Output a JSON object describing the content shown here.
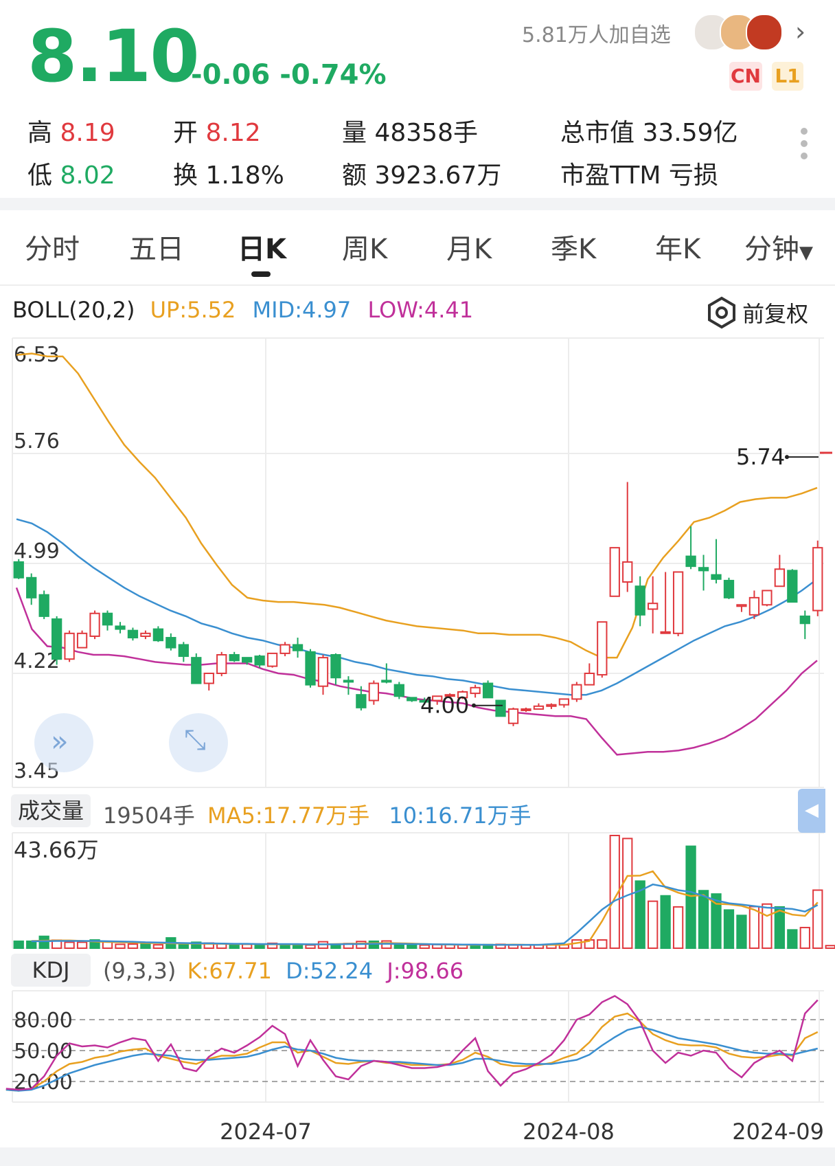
{
  "header": {
    "price": "8.10",
    "change": "-0.06 -0.74%",
    "followers": "5.81万人加自选",
    "badges": [
      "CN",
      "L1"
    ]
  },
  "stats": {
    "high_label": "高",
    "high": "8.19",
    "open_label": "开",
    "open": "8.12",
    "volume_label": "量",
    "volume": "48358手",
    "mktcap_label": "总市值",
    "mktcap": "33.59亿",
    "low_label": "低",
    "low": "8.02",
    "turnover_label": "换",
    "turnover": "1.18%",
    "amount_label": "额",
    "amount": "3923.67万",
    "pe_label": "市盈TTM",
    "pe": "亏损"
  },
  "tabs": [
    "分时",
    "五日",
    "日K",
    "周K",
    "月K",
    "季K",
    "年K",
    "分钟"
  ],
  "active_tab": "日K",
  "boll": {
    "name": "BOLL(20,2)",
    "up": "UP:5.52",
    "mid": "MID:4.97",
    "low": "LOW:4.41",
    "adjust": "前复权"
  },
  "colors": {
    "up": "#e0393e",
    "down": "#1faa62",
    "upper": "#e8a020",
    "mid": "#3a8fd0",
    "lower": "#c0309a"
  },
  "volume_legend": {
    "label": "成交量",
    "value": "19504手",
    "ma5": "MA5:17.77万手",
    "ma10": "10:16.71万手"
  },
  "kdj_legend": {
    "label": "KDJ",
    "params": "(9,3,3)",
    "k": "K:67.71",
    "d": "D:52.24",
    "j": "J:98.66"
  },
  "chart_data": [
    {
      "type": "candlestick",
      "title": "",
      "y_ticks": [
        "6.53",
        "5.76",
        "4.99",
        "4.22",
        "3.45"
      ],
      "ylim": [
        3.45,
        6.53
      ],
      "x_ticks": [
        "2024-07",
        "2024-08",
        "2024-09"
      ],
      "annotations": {
        "max": "5.74",
        "min": "4.00"
      },
      "candles": [
        [
          5.0,
          4.89,
          5.02,
          4.88
        ],
        [
          4.89,
          4.75,
          4.92,
          4.7
        ],
        [
          4.77,
          4.62,
          4.8,
          4.6
        ],
        [
          4.6,
          4.32,
          4.62,
          4.28
        ],
        [
          4.32,
          4.5,
          4.52,
          4.3
        ],
        [
          4.4,
          4.5,
          4.52,
          4.4
        ],
        [
          4.48,
          4.64,
          4.66,
          4.46
        ],
        [
          4.64,
          4.56,
          4.66,
          4.52
        ],
        [
          4.55,
          4.53,
          4.58,
          4.5
        ],
        [
          4.52,
          4.47,
          4.54,
          4.45
        ],
        [
          4.48,
          4.5,
          4.52,
          4.46
        ],
        [
          4.53,
          4.45,
          4.55,
          4.44
        ],
        [
          4.47,
          4.4,
          4.5,
          4.38
        ],
        [
          4.42,
          4.34,
          4.44,
          4.3
        ],
        [
          4.33,
          4.15,
          4.36,
          4.15
        ],
        [
          4.15,
          4.22,
          4.22,
          4.1
        ],
        [
          4.22,
          4.35,
          4.37,
          4.2
        ],
        [
          4.35,
          4.31,
          4.37,
          4.3
        ],
        [
          4.33,
          4.3,
          4.33,
          4.28
        ],
        [
          4.34,
          4.28,
          4.35,
          4.26
        ],
        [
          4.27,
          4.36,
          4.36,
          4.26
        ],
        [
          4.36,
          4.42,
          4.44,
          4.34
        ],
        [
          4.42,
          4.38,
          4.47,
          4.33
        ],
        [
          4.37,
          4.14,
          4.39,
          4.12
        ],
        [
          4.13,
          4.33,
          4.35,
          4.07
        ],
        [
          4.35,
          4.19,
          4.36,
          4.14
        ],
        [
          4.17,
          4.16,
          4.2,
          4.07
        ],
        [
          4.07,
          3.98,
          4.13,
          3.96
        ],
        [
          4.03,
          4.15,
          4.17,
          4.0
        ],
        [
          4.17,
          4.16,
          4.29,
          4.15
        ],
        [
          4.14,
          4.06,
          4.16,
          4.04
        ],
        [
          4.05,
          4.03,
          4.05,
          4.02
        ],
        [
          4.03,
          4.02,
          4.05,
          4.0
        ],
        [
          4.03,
          4.06,
          4.06,
          4.0
        ],
        [
          4.07,
          4.07,
          4.08,
          4.05
        ],
        [
          4.05,
          4.09,
          4.1,
          4.04
        ],
        [
          4.08,
          4.12,
          4.14,
          4.05
        ],
        [
          4.15,
          4.05,
          4.17,
          4.05
        ],
        [
          4.03,
          3.92,
          4.03,
          3.92
        ],
        [
          3.87,
          3.97,
          3.98,
          3.85
        ],
        [
          3.97,
          3.97,
          3.98,
          3.95
        ],
        [
          3.97,
          3.99,
          4.01,
          3.97
        ],
        [
          3.99,
          4.0,
          4.01,
          3.97
        ],
        [
          4.0,
          4.04,
          4.04,
          3.98
        ],
        [
          4.04,
          4.14,
          4.16,
          4.02
        ],
        [
          4.14,
          4.22,
          4.29,
          4.2
        ],
        [
          4.21,
          4.58,
          4.58,
          4.19
        ],
        [
          4.76,
          5.1,
          5.1,
          4.76
        ],
        [
          4.86,
          5.0,
          5.56,
          4.79
        ],
        [
          4.83,
          4.63,
          4.9,
          4.55
        ],
        [
          4.67,
          4.71,
          4.9,
          4.5
        ],
        [
          4.51,
          4.51,
          4.93,
          4.5
        ],
        [
          4.5,
          4.93,
          4.93,
          4.48
        ],
        [
          5.04,
          4.97,
          5.25,
          4.95
        ],
        [
          4.96,
          4.94,
          5.05,
          4.8
        ],
        [
          4.91,
          4.88,
          5.16,
          4.85
        ],
        [
          4.87,
          4.75,
          4.89,
          4.74
        ],
        [
          4.69,
          4.7,
          4.7,
          4.65
        ],
        [
          4.63,
          4.75,
          4.8,
          4.6
        ],
        [
          4.7,
          4.8,
          4.8,
          4.69
        ],
        [
          4.83,
          4.95,
          5.05,
          4.83
        ],
        [
          4.94,
          4.72,
          4.95,
          4.72
        ],
        [
          4.62,
          4.57,
          4.66,
          4.46
        ],
        [
          4.66,
          5.1,
          5.15,
          4.62
        ]
      ],
      "series": [
        {
          "name": "UP",
          "values": [
            6.45,
            6.46,
            6.44,
            6.44,
            6.32,
            6.15,
            5.98,
            5.82,
            5.7,
            5.59,
            5.45,
            5.31,
            5.13,
            4.98,
            4.84,
            4.75,
            4.73,
            4.72,
            4.72,
            4.71,
            4.7,
            4.68,
            4.65,
            4.62,
            4.59,
            4.57,
            4.55,
            4.54,
            4.53,
            4.52,
            4.5,
            4.5,
            4.49,
            4.49,
            4.49,
            4.47,
            4.44,
            4.38,
            4.33,
            4.33,
            4.54,
            4.88,
            5.03,
            5.15,
            5.28,
            5.31,
            5.36,
            5.42,
            5.44,
            5.45,
            5.45,
            5.48,
            5.52
          ]
        },
        {
          "name": "MID",
          "values": [
            5.3,
            5.27,
            5.21,
            5.13,
            5.04,
            4.96,
            4.89,
            4.82,
            4.76,
            4.71,
            4.66,
            4.62,
            4.57,
            4.54,
            4.5,
            4.47,
            4.45,
            4.42,
            4.4,
            4.37,
            4.35,
            4.33,
            4.3,
            4.28,
            4.25,
            4.23,
            4.21,
            4.2,
            4.18,
            4.17,
            4.15,
            4.13,
            4.11,
            4.1,
            4.09,
            4.08,
            4.07,
            4.07,
            4.1,
            4.15,
            4.21,
            4.27,
            4.33,
            4.39,
            4.45,
            4.5,
            4.55,
            4.58,
            4.62,
            4.67,
            4.73,
            4.8,
            4.88
          ]
        },
        {
          "name": "LOW",
          "values": [
            4.82,
            4.53,
            4.41,
            4.4,
            4.37,
            4.35,
            4.35,
            4.34,
            4.32,
            4.3,
            4.29,
            4.28,
            4.28,
            4.29,
            4.29,
            4.29,
            4.25,
            4.22,
            4.21,
            4.18,
            4.16,
            4.13,
            4.11,
            4.09,
            4.08,
            4.06,
            4.04,
            4.03,
            4.02,
            4.01,
            3.98,
            3.96,
            3.95,
            3.94,
            3.93,
            3.92,
            3.92,
            3.9,
            3.77,
            3.65,
            3.66,
            3.67,
            3.67,
            3.68,
            3.7,
            3.73,
            3.77,
            3.83,
            3.9,
            4.0,
            4.1,
            4.22,
            4.31
          ]
        }
      ]
    },
    {
      "type": "bar",
      "title": "",
      "y_ticks": [
        "43.66万"
      ],
      "values_wan": [
        2.7,
        2.7,
        4.6,
        3.1,
        2.3,
        2.3,
        3.2,
        2.6,
        1.5,
        1.6,
        1.6,
        1.3,
        4.0,
        1.3,
        2.3,
        2.0,
        1.8,
        1.5,
        1.5,
        1.4,
        1.9,
        1.3,
        1.3,
        1.2,
        2.5,
        1.6,
        1.8,
        2.6,
        2.7,
        2.8,
        1.3,
        1.3,
        1.2,
        1.4,
        1.4,
        1.3,
        1.2,
        1.4,
        1.5,
        1.2,
        1.3,
        1.3,
        1.3,
        1.3,
        3.2,
        3.2,
        3.2,
        43.66,
        42.5,
        26.0,
        18.2,
        20.3,
        16.0,
        39.5,
        22.3,
        21.0,
        14.8,
        12.7,
        16.1,
        17.1,
        16.0,
        7.1,
        8.0,
        22.5,
        1.0
      ],
      "up": [
        false,
        false,
        false,
        true,
        true,
        true,
        false,
        true,
        true,
        true,
        false,
        true,
        false,
        false,
        false,
        true,
        true,
        false,
        true,
        false,
        true,
        false,
        false,
        true,
        true,
        false,
        true,
        true,
        false,
        true,
        false,
        false,
        true,
        true,
        true,
        true,
        false,
        false,
        true,
        true,
        true,
        true,
        true,
        true,
        true,
        true,
        true,
        true,
        true,
        false,
        true,
        false,
        true,
        false,
        false,
        false,
        false,
        false,
        true,
        true,
        false,
        false,
        true,
        true,
        true
      ],
      "series": [
        {
          "name": "MA5",
          "values": [
            2.8,
            2.9,
            3.0,
            3.0,
            2.8,
            2.6,
            2.4,
            2.3,
            2.2,
            2.0,
            2.0,
            1.9,
            1.8,
            1.8,
            1.7,
            1.7,
            1.6,
            1.6,
            1.6,
            1.5,
            1.5,
            1.5,
            1.5,
            1.5,
            1.6,
            1.7,
            1.8,
            1.9,
            2.0,
            1.9,
            1.8,
            1.6,
            1.5,
            1.4,
            1.3,
            1.3,
            1.3,
            1.3,
            1.4,
            1.3,
            1.3,
            1.3,
            1.3,
            2.0,
            2.8,
            10.5,
            19.4,
            28.0,
            28.1,
            29.8,
            23.5,
            21.5,
            20.2,
            20.6,
            17.2,
            17.0,
            16.4,
            14.9,
            12.5,
            14.6,
            13.0,
            12.5,
            17.77
          ]
        },
        {
          "name": "MA10",
          "values": [
            2.7,
            2.7,
            2.8,
            2.8,
            2.8,
            2.8,
            2.7,
            2.6,
            2.5,
            2.3,
            2.2,
            2.1,
            2.0,
            1.9,
            1.9,
            1.8,
            1.7,
            1.7,
            1.6,
            1.6,
            1.6,
            1.6,
            1.5,
            1.5,
            1.5,
            1.6,
            1.6,
            1.7,
            1.7,
            1.7,
            1.6,
            1.6,
            1.5,
            1.5,
            1.4,
            1.4,
            1.3,
            1.3,
            1.3,
            1.3,
            1.3,
            1.6,
            1.9,
            5.9,
            10.4,
            15.0,
            18.4,
            20.5,
            22.3,
            24.7,
            23.8,
            22.5,
            21.8,
            20.2,
            18.5,
            17.4,
            16.9,
            16.3,
            15.7,
            15.5,
            15.2,
            14.2,
            16.71
          ]
        }
      ]
    },
    {
      "type": "line",
      "title": "",
      "y_ticks": [
        "80.00",
        "50.00",
        "20.00"
      ],
      "ylim": [
        0,
        108
      ],
      "series": [
        {
          "name": "K",
          "values": [
            12,
            11,
            13,
            20,
            30,
            37,
            39,
            43,
            45,
            49,
            51,
            52,
            45,
            42,
            39,
            37,
            42,
            45,
            45,
            47,
            53,
            58,
            58,
            48,
            50,
            44,
            38,
            37,
            39,
            40,
            38,
            38,
            36,
            36,
            36,
            37,
            41,
            48,
            44,
            37,
            35,
            35,
            36,
            38,
            43,
            47,
            58,
            73,
            83,
            86,
            78,
            66,
            60,
            56,
            55,
            55,
            53,
            47,
            44,
            43,
            44,
            46,
            45,
            62,
            68
          ]
        },
        {
          "name": "D",
          "values": [
            12,
            11,
            12,
            16,
            22,
            28,
            32,
            36,
            39,
            42,
            45,
            47,
            46,
            45,
            42,
            41,
            41,
            42,
            43,
            44,
            47,
            51,
            54,
            51,
            50,
            47,
            43,
            41,
            40,
            40,
            39,
            39,
            38,
            37,
            36,
            36,
            38,
            42,
            42,
            40,
            38,
            37,
            37,
            37,
            39,
            41,
            46,
            55,
            63,
            70,
            73,
            70,
            66,
            62,
            60,
            58,
            56,
            53,
            50,
            48,
            47,
            47,
            46,
            49,
            52
          ]
        },
        {
          "name": "J",
          "values": [
            13,
            12,
            13,
            25,
            45,
            57,
            54,
            55,
            53,
            58,
            62,
            60,
            40,
            56,
            33,
            30,
            44,
            52,
            48,
            55,
            63,
            74,
            66,
            35,
            60,
            41,
            25,
            22,
            35,
            40,
            39,
            36,
            33,
            33,
            34,
            37,
            50,
            62,
            30,
            16,
            28,
            32,
            38,
            46,
            60,
            80,
            85,
            97,
            103,
            95,
            78,
            50,
            38,
            48,
            45,
            50,
            48,
            33,
            24,
            38,
            45,
            50,
            40,
            86,
            99
          ]
        }
      ]
    }
  ]
}
